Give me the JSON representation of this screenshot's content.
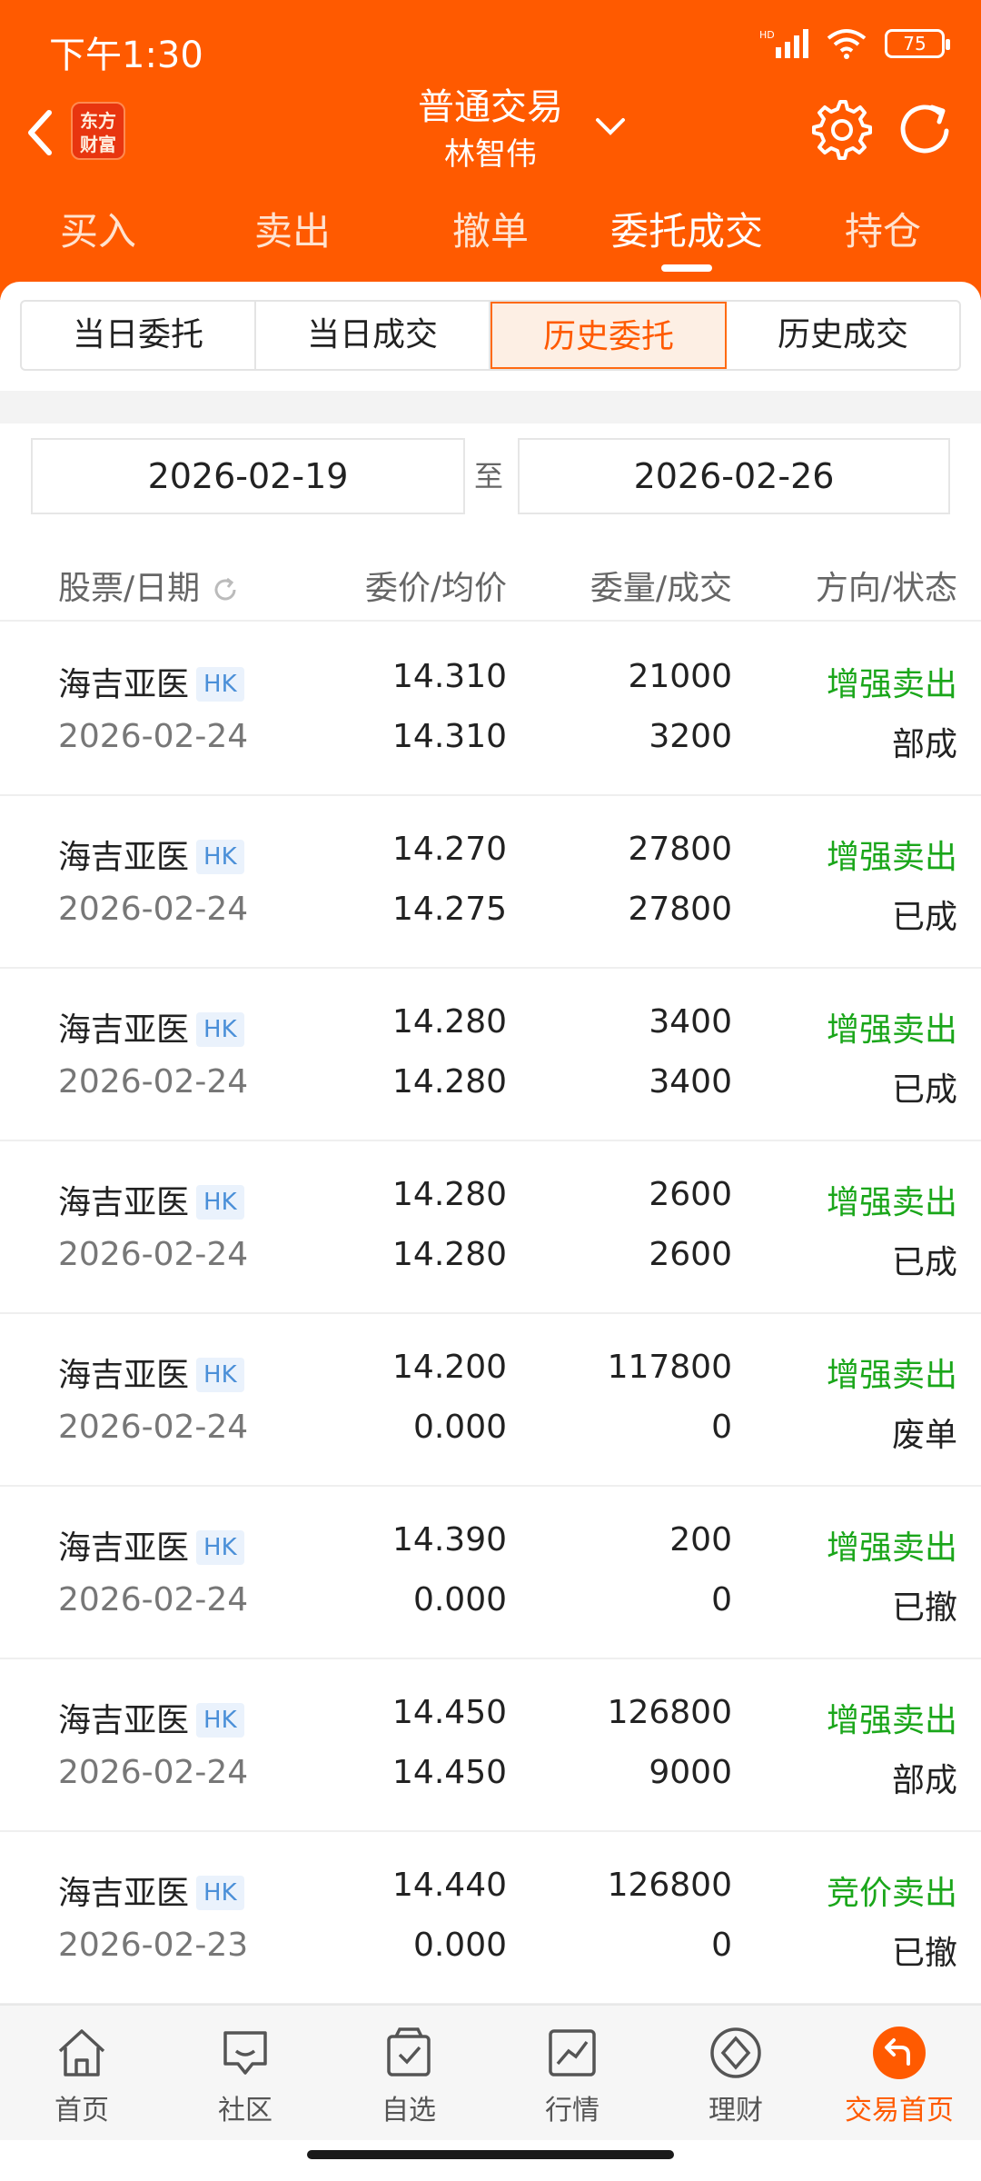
{
  "status_bar": {
    "time": "下午1:30",
    "battery": "75"
  },
  "header": {
    "logo_text": "东方\n财富",
    "title": "普通交易",
    "account_name": "林智伟"
  },
  "top_tabs": [
    {
      "label": "买入"
    },
    {
      "label": "卖出"
    },
    {
      "label": "撤单"
    },
    {
      "label": "委托成交",
      "active": true
    },
    {
      "label": "持仓"
    }
  ],
  "segments": [
    {
      "label": "当日委托"
    },
    {
      "label": "当日成交"
    },
    {
      "label": "历史委托",
      "active": true
    },
    {
      "label": "历史成交"
    }
  ],
  "date_range": {
    "start": "2026-02-19",
    "separator": "至",
    "end": "2026-02-26"
  },
  "columns": {
    "stock_date": "股票/日期",
    "price": "委价/均价",
    "qty": "委量/成交",
    "direction_status": "方向/状态"
  },
  "orders": [
    {
      "name": "海吉亚医",
      "market": "HK",
      "date": "2026-02-24",
      "price": "14.310",
      "avg": "14.310",
      "qty": "21000",
      "deal": "3200",
      "direction": "增强卖出",
      "status": "部成"
    },
    {
      "name": "海吉亚医",
      "market": "HK",
      "date": "2026-02-24",
      "price": "14.270",
      "avg": "14.275",
      "qty": "27800",
      "deal": "27800",
      "direction": "增强卖出",
      "status": "已成"
    },
    {
      "name": "海吉亚医",
      "market": "HK",
      "date": "2026-02-24",
      "price": "14.280",
      "avg": "14.280",
      "qty": "3400",
      "deal": "3400",
      "direction": "增强卖出",
      "status": "已成"
    },
    {
      "name": "海吉亚医",
      "market": "HK",
      "date": "2026-02-24",
      "price": "14.280",
      "avg": "14.280",
      "qty": "2600",
      "deal": "2600",
      "direction": "增强卖出",
      "status": "已成"
    },
    {
      "name": "海吉亚医",
      "market": "HK",
      "date": "2026-02-24",
      "price": "14.200",
      "avg": "0.000",
      "qty": "117800",
      "deal": "0",
      "direction": "增强卖出",
      "status": "废单"
    },
    {
      "name": "海吉亚医",
      "market": "HK",
      "date": "2026-02-24",
      "price": "14.390",
      "avg": "0.000",
      "qty": "200",
      "deal": "0",
      "direction": "增强卖出",
      "status": "已撤"
    },
    {
      "name": "海吉亚医",
      "market": "HK",
      "date": "2026-02-24",
      "price": "14.450",
      "avg": "14.450",
      "qty": "126800",
      "deal": "9000",
      "direction": "增强卖出",
      "status": "部成"
    },
    {
      "name": "海吉亚医",
      "market": "HK",
      "date": "2026-02-23",
      "price": "14.440",
      "avg": "0.000",
      "qty": "126800",
      "deal": "0",
      "direction": "竞价卖出",
      "status": "已撤"
    }
  ],
  "bottom_nav": [
    {
      "label": "首页",
      "icon": "home-icon"
    },
    {
      "label": "社区",
      "icon": "community-icon"
    },
    {
      "label": "自选",
      "icon": "watchlist-icon"
    },
    {
      "label": "行情",
      "icon": "market-icon"
    },
    {
      "label": "理财",
      "icon": "wealth-icon"
    },
    {
      "label": "交易首页",
      "icon": "trade-home-icon",
      "active": true
    }
  ],
  "colors": {
    "brand": "#ff5a00",
    "sell_green": "#1aa61a",
    "hk_blue": "#4a8fd8"
  }
}
